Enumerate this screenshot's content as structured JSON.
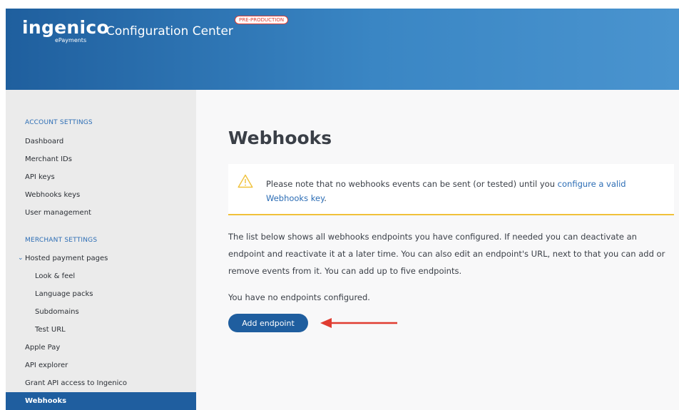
{
  "header": {
    "logo_main": "ingenico",
    "logo_sub": "ePayments",
    "app_title": "Configuration Center",
    "env_badge": "PRE-PRODUCTION"
  },
  "sidebar": {
    "account_section": "ACCOUNT SETTINGS",
    "account_items": [
      "Dashboard",
      "Merchant IDs",
      "API keys",
      "Webhooks keys",
      "User management"
    ],
    "merchant_section": "MERCHANT SETTINGS",
    "hosted_pages": "Hosted payment pages",
    "hosted_sub_items": [
      "Look & feel",
      "Language packs",
      "Subdomains",
      "Test URL"
    ],
    "merchant_items": [
      "Apple Pay",
      "API explorer",
      "Grant API access to Ingenico"
    ],
    "active_item": "Webhooks"
  },
  "main": {
    "title": "Webhooks",
    "notice_text": "Please note that no webhooks events can be sent (or tested) until you ",
    "notice_link": "configure a valid Webhooks key",
    "notice_end": ".",
    "description": "The list below shows all webhooks endpoints you have configured. If needed you can deactivate an endpoint and reactivate it at a later time. You can also edit an endpoint's URL, next to that you can add or remove events from it. You can add up to five endpoints.",
    "empty_message": "You have no endpoints configured.",
    "add_button": "Add endpoint"
  },
  "colors": {
    "brand_blue": "#1f5e9f",
    "link_blue": "#2c6db5",
    "warning_yellow": "#f0c13a",
    "annotation_red": "#e03c31"
  },
  "icons": [
    "chevron-down-icon",
    "warning-icon",
    "arrow-left-icon"
  ]
}
